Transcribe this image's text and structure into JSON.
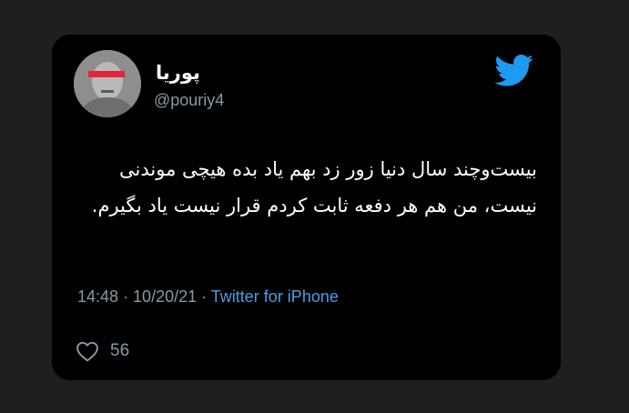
{
  "tweet": {
    "display_name": "پوریا",
    "handle": "@pouriy4",
    "text": "بیست‌وچند سال دنیا زور زد بهم یاد بده هیچی موندنی نیست، من هم هر دفعه ثابت کردم قرار نیست یاد بگیرم.",
    "time": "14:48",
    "separator": " · ",
    "date": "10/20/21",
    "source": "Twitter for iPhone",
    "like_count": "56"
  },
  "icons": {
    "brand": "twitter-bird-icon",
    "like": "heart-icon"
  },
  "colors": {
    "background": "#1f1f1f",
    "card": "#000000",
    "text": "#ffffff",
    "muted": "#8b98a5",
    "accent": "#1d9bf0",
    "censor_bar": "#e0253a"
  }
}
